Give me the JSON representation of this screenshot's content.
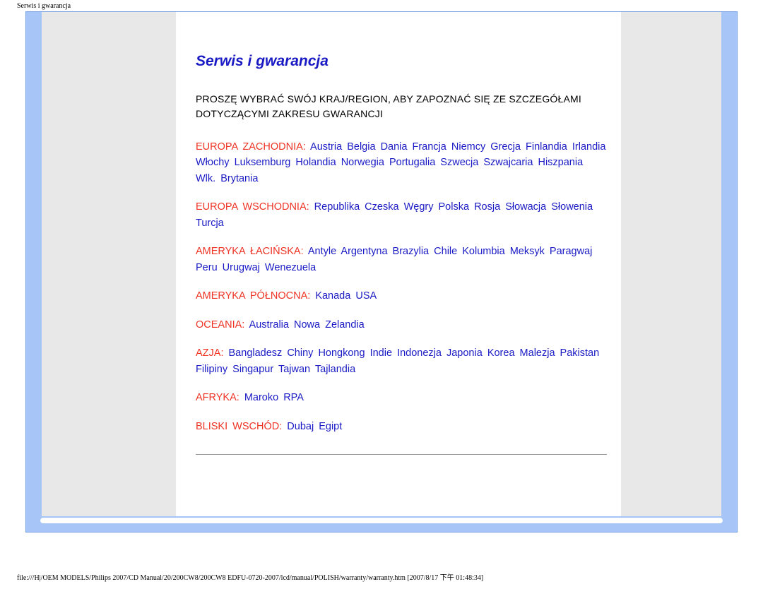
{
  "topLabel": "Serwis i gwarancja",
  "title": "Serwis i gwarancja",
  "instruction": "PROSZĘ WYBRAĆ SWÓJ KRAJ/REGION, ABY ZAPOZNAĆ SIĘ ZE SZCZEGÓŁAMI DOTYCZĄCYMI ZAKRESU GWARANCJI",
  "regions": [
    {
      "label": "EUROPA ZACHODNIA:",
      "countries": [
        "Austria",
        "Belgia",
        "Dania",
        "Francja",
        "Niemcy",
        "Grecja",
        "Finlandia",
        "Irlandia",
        "Włochy",
        "Luksemburg",
        "Holandia",
        "Norwegia",
        "Portugalia",
        "Szwecja",
        "Szwajcaria",
        "Hiszpania",
        "Wlk. Brytania"
      ]
    },
    {
      "label": "EUROPA WSCHODNIA:",
      "countries": [
        "Republika Czeska",
        "Węgry",
        "Polska",
        "Rosja",
        "Słowacja",
        "Słowenia",
        "Turcja"
      ]
    },
    {
      "label": "AMERYKA ŁACIŃSKA:",
      "countries": [
        "Antyle",
        "Argentyna",
        "Brazylia",
        "Chile",
        "Kolumbia",
        "Meksyk",
        "Paragwaj",
        "Peru",
        "Urugwaj",
        "Wenezuela"
      ]
    },
    {
      "label": "AMERYKA PÓŁNOCNA:",
      "countries": [
        "Kanada",
        "USA"
      ]
    },
    {
      "label": "OCEANIA:",
      "countries": [
        "Australia",
        "Nowa Zelandia"
      ]
    },
    {
      "label": "AZJA:",
      "countries": [
        "Bangladesz",
        "Chiny",
        "Hongkong",
        "Indie",
        "Indonezja",
        "Japonia",
        "Korea",
        "Malezja",
        "Pakistan",
        "Filipiny",
        "Singapur",
        "Tajwan",
        "Tajlandia"
      ]
    },
    {
      "label": "AFRYKA:",
      "countries": [
        "Maroko",
        "RPA"
      ]
    },
    {
      "label": "BLISKI WSCHÓD:",
      "countries": [
        "Dubaj",
        "Egipt"
      ]
    }
  ],
  "footer": "file:///H|/OEM MODELS/Philips 2007/CD Manual/20/200CW8/200CW8 EDFU-0720-2007/lcd/manual/POLISH/warranty/warranty.htm [2007/8/17 下午 01:48:34]"
}
